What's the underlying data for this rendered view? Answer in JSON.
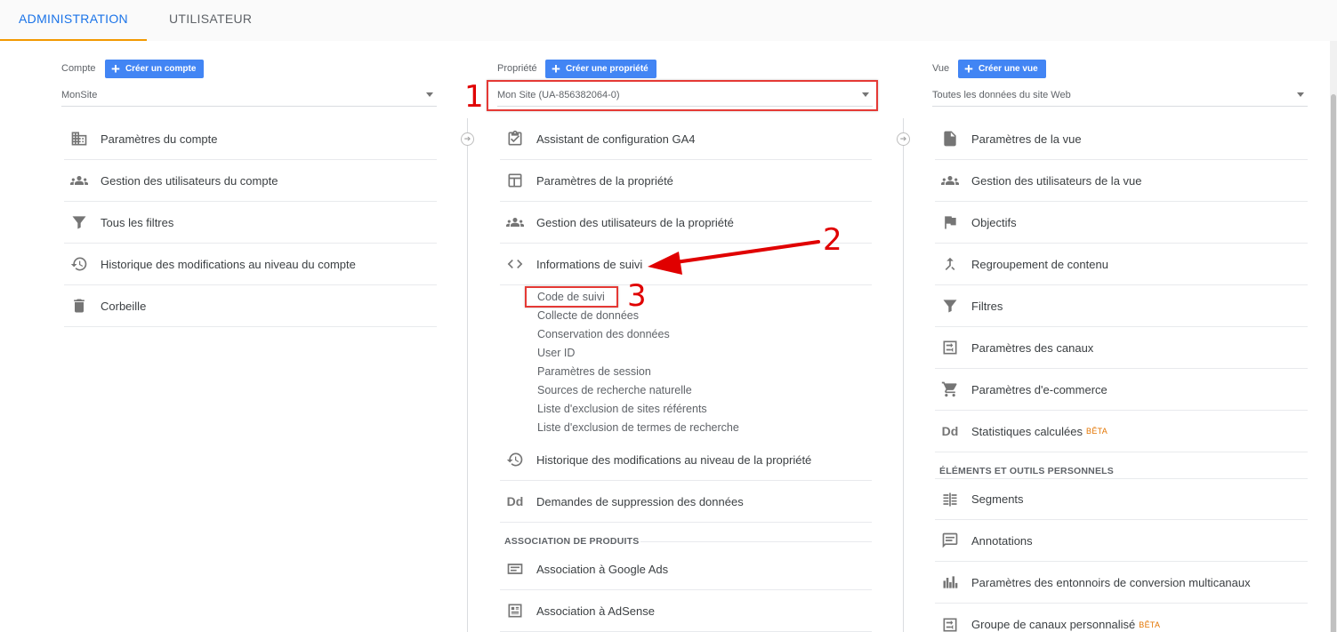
{
  "tabs": {
    "admin": "ADMINISTRATION",
    "user": "UTILISATEUR"
  },
  "account": {
    "label": "Compte",
    "create_label": "Créer un compte",
    "selected": "MonSite",
    "items": [
      {
        "label": "Paramètres du compte",
        "icon": "building-icon"
      },
      {
        "label": "Gestion des utilisateurs du compte",
        "icon": "people-icon"
      },
      {
        "label": "Tous les filtres",
        "icon": "filter-icon"
      },
      {
        "label": "Historique des modifications au niveau du compte",
        "icon": "history-icon"
      },
      {
        "label": "Corbeille",
        "icon": "trash-icon"
      }
    ]
  },
  "property": {
    "label": "Propriété",
    "create_label": "Créer une propriété",
    "selected": "Mon Site (UA-856382064-0)",
    "items": [
      {
        "label": "Assistant de configuration GA4",
        "icon": "clipboard-check-icon"
      },
      {
        "label": "Paramètres de la propriété",
        "icon": "layout-icon"
      },
      {
        "label": "Gestion des utilisateurs de la propriété",
        "icon": "people-icon"
      },
      {
        "label": "Informations de suivi",
        "icon": "code-icon"
      }
    ],
    "subitems": [
      "Code de suivi",
      "Collecte de données",
      "Conservation des données",
      "User ID",
      "Paramètres de session",
      "Sources de recherche naturelle",
      "Liste d'exclusion de sites référents",
      "Liste d'exclusion de termes de recherche"
    ],
    "items_after": [
      {
        "label": "Historique des modifications au niveau de la propriété",
        "icon": "history-icon"
      },
      {
        "label": "Demandes de suppression des données",
        "icon": "dd-icon"
      }
    ],
    "section_title": "ASSOCIATION DE PRODUITS",
    "section_items": [
      {
        "label": "Association à Google Ads",
        "icon": "ads-icon"
      },
      {
        "label": "Association à AdSense",
        "icon": "adsense-icon"
      }
    ]
  },
  "view": {
    "label": "Vue",
    "create_label": "Créer une vue",
    "selected": "Toutes les données du site Web",
    "items": [
      {
        "label": "Paramètres de la vue",
        "icon": "document-icon"
      },
      {
        "label": "Gestion des utilisateurs de la vue",
        "icon": "people-icon"
      },
      {
        "label": "Objectifs",
        "icon": "flag-icon"
      },
      {
        "label": "Regroupement de contenu",
        "icon": "merge-icon"
      },
      {
        "label": "Filtres",
        "icon": "filter-icon"
      },
      {
        "label": "Paramètres des canaux",
        "icon": "channels-icon"
      },
      {
        "label": "Paramètres d'e-commerce",
        "icon": "cart-icon"
      },
      {
        "label": "Statistiques calculées",
        "icon": "dd-icon",
        "badge": "BÊTA"
      }
    ],
    "section_title": "ÉLÉMENTS ET OUTILS PERSONNELS",
    "section_items": [
      {
        "label": "Segments",
        "icon": "segments-icon"
      },
      {
        "label": "Annotations",
        "icon": "annotation-icon"
      },
      {
        "label": "Paramètres des entonnoirs de conversion multicanaux",
        "icon": "bar-chart-icon"
      },
      {
        "label": "Groupe de canaux personnalisé",
        "icon": "channels-icon",
        "badge": "BÊTA"
      }
    ]
  },
  "annotations": {
    "one": "1",
    "two": "2",
    "three": "3",
    "color": "#e53935"
  },
  "colors": {
    "primary": "#4285f4",
    "tab_active": "#1a73e8",
    "tab_underline": "#f29900",
    "beta": "#e37400"
  }
}
